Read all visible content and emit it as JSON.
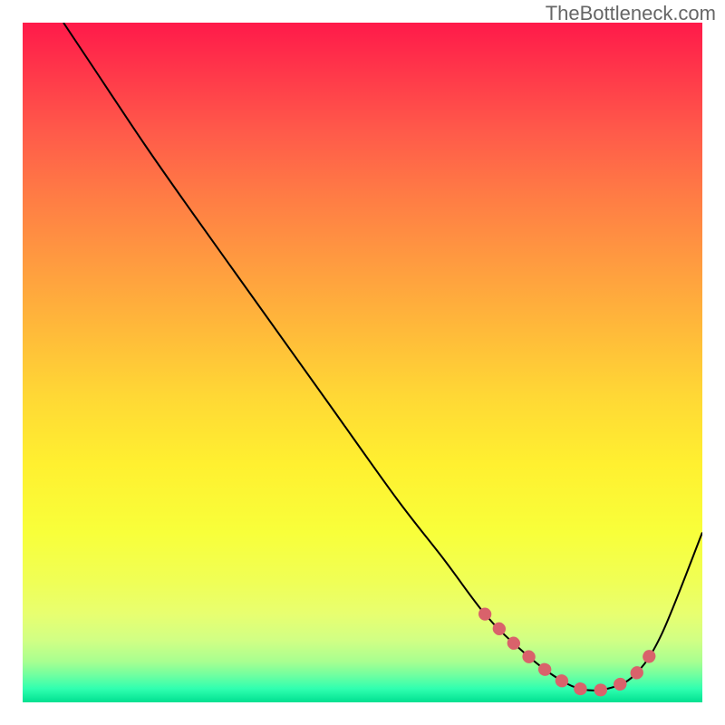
{
  "watermark": "TheBottleneck.com",
  "chart_data": {
    "type": "line",
    "title": "",
    "xlabel": "",
    "ylabel": "",
    "xlim": [
      0,
      100
    ],
    "ylim": [
      0,
      100
    ],
    "series": [
      {
        "name": "curve",
        "color": "#000000",
        "x": [
          6,
          10,
          18,
          25,
          35,
          45,
          55,
          62,
          68,
          73,
          78,
          82,
          86,
          90,
          94,
          100
        ],
        "y": [
          100,
          94,
          82,
          72,
          58,
          44,
          30,
          21,
          13,
          8,
          4,
          2,
          2,
          4,
          10,
          25
        ]
      },
      {
        "name": "highlight",
        "color": "#d9626b",
        "x": [
          68,
          73,
          78,
          82,
          86,
          90,
          93
        ],
        "y": [
          13,
          8,
          4,
          2,
          2,
          4,
          8
        ]
      }
    ]
  }
}
